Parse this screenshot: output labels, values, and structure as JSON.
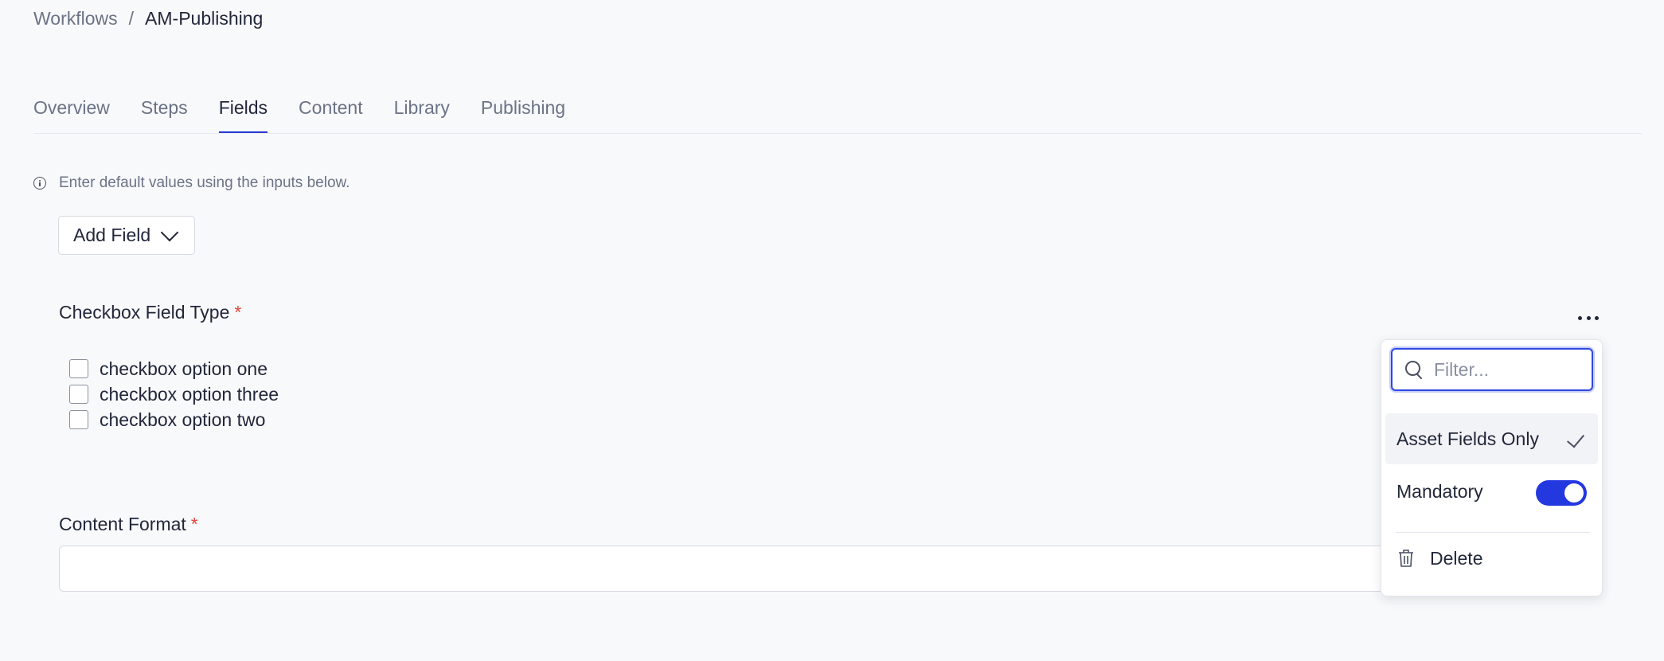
{
  "breadcrumb": {
    "parent": "Workflows",
    "separator": "/",
    "current": "AM-Publishing"
  },
  "tabs": [
    {
      "label": "Overview",
      "active": false
    },
    {
      "label": "Steps",
      "active": false
    },
    {
      "label": "Fields",
      "active": true
    },
    {
      "label": "Content",
      "active": false
    },
    {
      "label": "Library",
      "active": false
    },
    {
      "label": "Publishing",
      "active": false
    }
  ],
  "info": {
    "icon": "info-icon",
    "text": "Enter default values using the inputs below."
  },
  "add_field": {
    "label": "Add Field",
    "icon": "chevron-down-icon"
  },
  "checkbox_field": {
    "label": "Checkbox Field Type",
    "required_mark": "*",
    "options": [
      "checkbox option one",
      "checkbox option three",
      "checkbox option two"
    ]
  },
  "content_format": {
    "label": "Content Format",
    "required_mark": "*",
    "value": ""
  },
  "field_menu": {
    "trigger_icon": "more-horizontal-icon",
    "filter_placeholder": "Filter...",
    "items": {
      "asset_fields_only": {
        "label": "Asset Fields Only",
        "checked": true
      },
      "mandatory": {
        "label": "Mandatory",
        "toggle_on": true
      },
      "delete": {
        "label": "Delete",
        "icon": "trash-icon"
      }
    }
  },
  "colors": {
    "accent": "#2438e0",
    "required": "#e0463c",
    "active_tab_underline": "#2a3ad1"
  }
}
